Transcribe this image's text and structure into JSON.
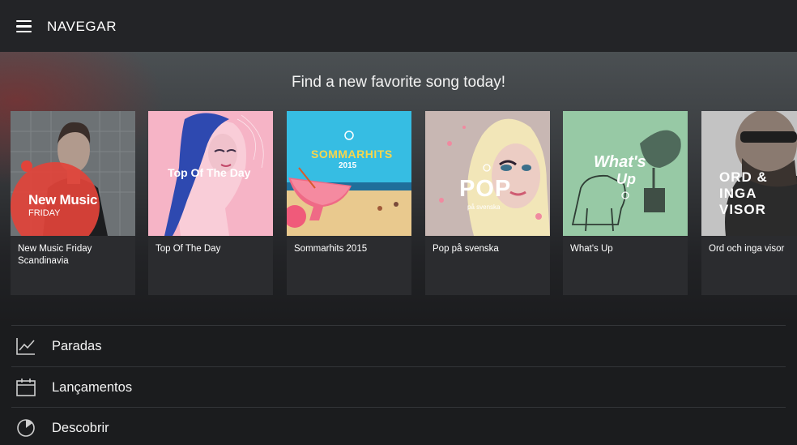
{
  "header": {
    "title": "NAVEGAR",
    "menu_icon": "hamburger-icon"
  },
  "hero": {
    "title": "Find a new favorite song today!"
  },
  "playlists": [
    {
      "label": "New Music Friday Scandinavia",
      "art_text": "New Music",
      "art_subtext": "FRIDAY",
      "accent": "#e2433a"
    },
    {
      "label": "Top Of The Day",
      "art_text": "Top Of The Day",
      "accent": "#f4a0b6"
    },
    {
      "label": "Sommarhits 2015",
      "art_text": "SOMMARHITS",
      "art_subtext": "2015",
      "accent": "#e8c64a"
    },
    {
      "label": "Pop på svenska",
      "art_text": "POP",
      "art_subtext": "på svenska",
      "accent": "#d7b9b2"
    },
    {
      "label": "What's Up",
      "art_text": "What's",
      "art_subtext": "Up",
      "accent": "#8fc39e"
    },
    {
      "label": "Ord och inga visor",
      "art_text": "ORD & INGA VISOR",
      "accent": "#c9c9c9"
    }
  ],
  "menu": [
    {
      "label": "Paradas",
      "icon": "chart-line-icon"
    },
    {
      "label": "Lançamentos",
      "icon": "calendar-icon"
    },
    {
      "label": "Descobrir",
      "icon": "compass-pie-icon"
    }
  ]
}
